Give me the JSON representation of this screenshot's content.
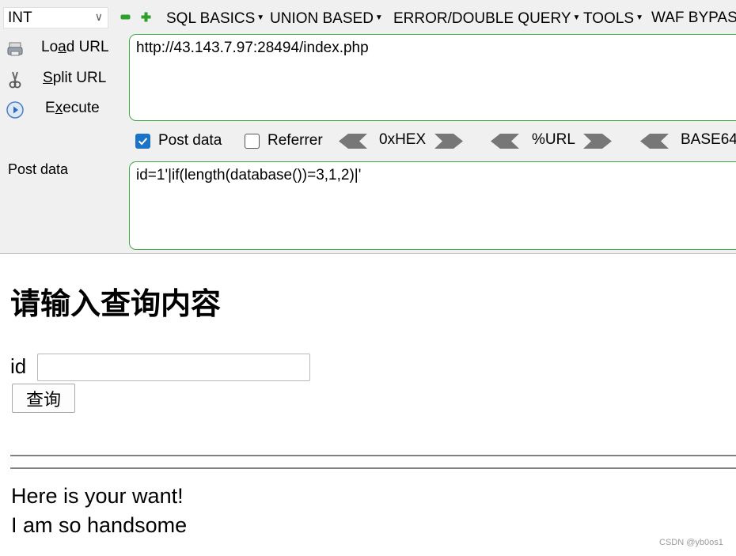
{
  "toolbar": {
    "type_select_value": "INT",
    "menus": [
      "SQL BASICS",
      "UNION BASED",
      "ERROR/DOUBLE QUERY",
      "TOOLS",
      "WAF BYPAS"
    ]
  },
  "sidebar": {
    "load_url_prefix": "Lo",
    "load_url_ul": "a",
    "load_url_suffix": "d URL",
    "split_url_ul": "S",
    "split_url_suffix": "plit URL",
    "execute_prefix": "E",
    "execute_ul": "x",
    "execute_suffix": "ecute"
  },
  "url_field": {
    "value": "http://43.143.7.97:28494/index.php"
  },
  "options": {
    "post_data_label": "Post data",
    "post_data_checked": true,
    "referrer_label": "Referrer",
    "referrer_checked": false,
    "encoders": [
      "0xHEX",
      "%URL",
      "BASE64"
    ]
  },
  "post_section": {
    "label": "Post data",
    "value": "id=1'|if(length(database())=3,1,2)|'"
  },
  "page": {
    "title": "请输入查询内容",
    "id_label": "id",
    "id_value": "",
    "query_button": "查询",
    "output_lines": [
      "Here is your want!",
      "I am so handsome"
    ]
  },
  "watermark": "CSDN @yb0os1",
  "colors": {
    "accent_green": "#44a844",
    "checkbox_blue": "#1a73c7",
    "panel_bg": "#f0f0f0"
  }
}
